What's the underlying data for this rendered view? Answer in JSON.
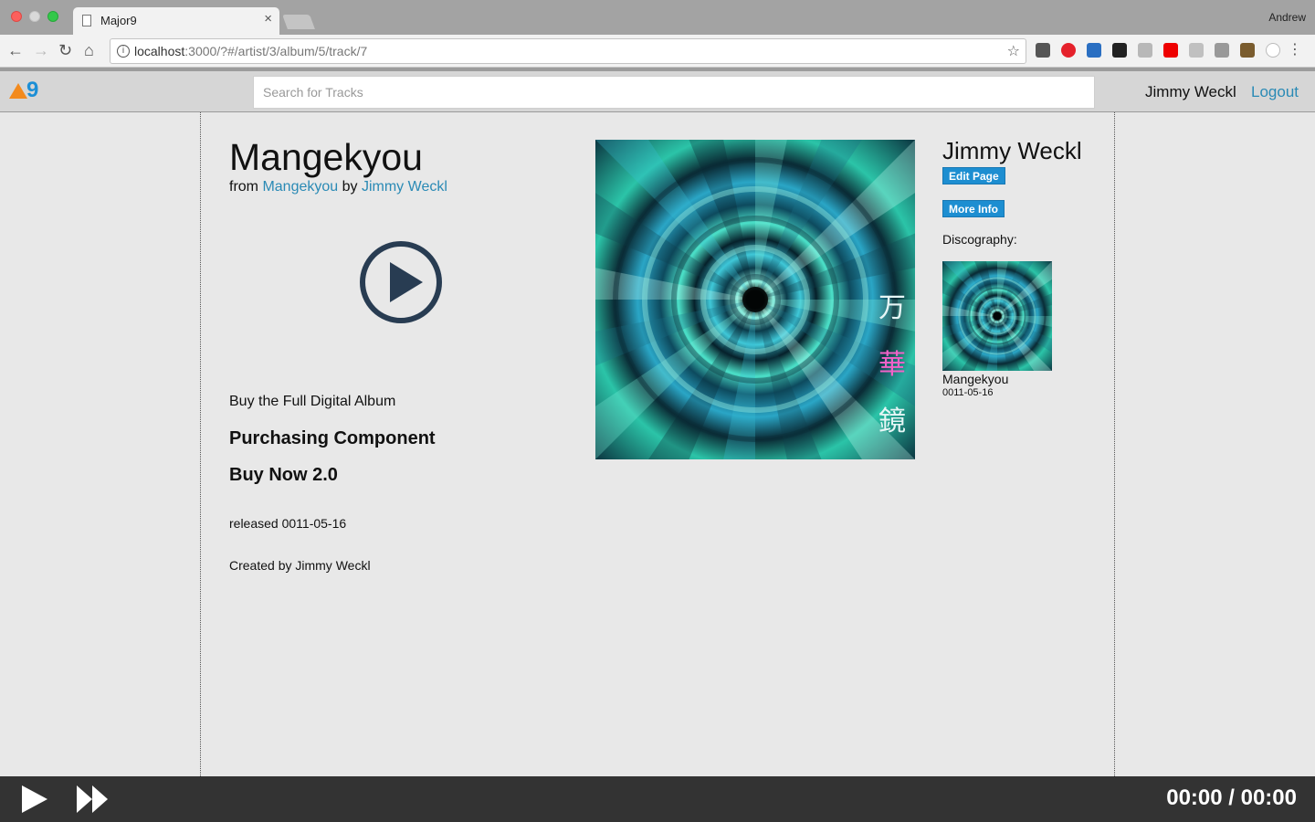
{
  "browser": {
    "tab_title": "Major9",
    "tab_close": "×",
    "profile_name": "Andrew",
    "url_host": "localhost",
    "url_path": ":3000/?#/artist/3/album/5/track/7",
    "nav_back": "←",
    "nav_forward": "→",
    "nav_reload": "↻",
    "nav_home": "⌂",
    "bookmark_star": "☆",
    "info_icon": "i",
    "menu": "⋮"
  },
  "app": {
    "logo_text": "9",
    "logo_accent": "#f38a1d",
    "logo_color": "#1c8fd6",
    "search_placeholder": "Search for Tracks",
    "user_name": "Jimmy Weckl",
    "logout_label": "Logout"
  },
  "track": {
    "title": "Mangekyou",
    "from_label": "from ",
    "album_link": "Mangekyou",
    "by_label": " by ",
    "artist_link": "Jimmy Weckl",
    "buy_full": "Buy the Full Digital Album",
    "purchasing": "Purchasing Component",
    "buy_now": "Buy Now 2.0",
    "released": "released 0011-05-16",
    "created_by": "Created by Jimmy Weckl"
  },
  "cover": {
    "kanji": [
      "万",
      "華",
      "鏡"
    ],
    "kanji_colors": [
      "#e6f6f6",
      "#f062c8",
      "#e6f6f6"
    ]
  },
  "artist": {
    "name": "Jimmy Weckl",
    "edit_page": "Edit Page",
    "more_info": "More Info",
    "discography_label": "Discography:",
    "albums": [
      {
        "title": "Mangekyou",
        "date": "0011-05-16"
      }
    ]
  },
  "player": {
    "time": "00:00 / 00:00"
  },
  "colors": {
    "link": "#2a8ab5",
    "button": "#1d8ed1",
    "player_bg": "#333333",
    "play_icon": "#283c52"
  }
}
